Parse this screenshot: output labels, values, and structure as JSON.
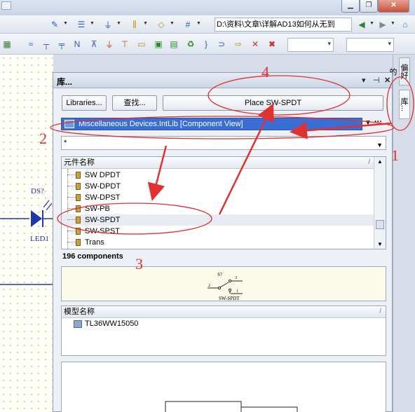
{
  "toolbar": {
    "path": "D:\\资料\\文章\\详解AD13如何从无到"
  },
  "panel": {
    "title": "库...",
    "buttons": {
      "libraries": "Libraries...",
      "search": "查找...",
      "place": "Place SW-SPDT"
    },
    "library": "Miscellaneous Devices.IntLib [Component View]",
    "more": "···",
    "filter": "*",
    "components": {
      "header": "元件名称",
      "items": [
        "SW DPDT",
        "SW-DPDT",
        "SW-DPST",
        "SW-PB",
        "SW-SPDT",
        "SW-SPST",
        "Trans"
      ],
      "selected": "SW-SPDT",
      "count": "196 components"
    },
    "preview": {
      "ref": "S?",
      "pin1": "1",
      "pin2": "2",
      "pin3": "3",
      "name": "SW-SPDT"
    },
    "models": {
      "header": "模型名称",
      "items": [
        "TL36WW15050"
      ]
    }
  },
  "side_tabs": {
    "favorites": "偏好的",
    "library": "库..."
  },
  "schematic": {
    "ref": "DS?",
    "name": "LED1"
  },
  "annotations": [
    "1",
    "2",
    "3",
    "4"
  ],
  "colors": {
    "annotation": "#e03030",
    "selection": "#3a6ed5",
    "preview_bg": "#fbfbea"
  }
}
